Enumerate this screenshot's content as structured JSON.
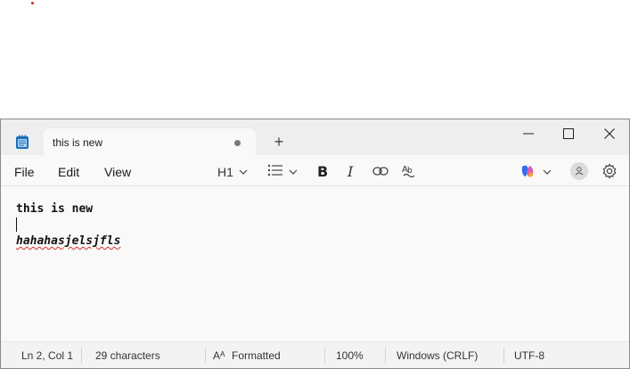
{
  "window": {
    "tab_title": "this is new",
    "new_tab_label": "+"
  },
  "menu": {
    "file": "File",
    "edit": "Edit",
    "view": "View"
  },
  "toolbar": {
    "heading_label": "H1",
    "bold_label": "B",
    "italic_label": "I",
    "icons": [
      "notepad-icon",
      "chevron-down-icon",
      "bulleted-list-icon",
      "link-icon",
      "spellcheck-icon",
      "copilot-icon",
      "account-icon",
      "gear-icon"
    ]
  },
  "editor": {
    "lines": [
      "this is new",
      "",
      "hahahasjelsjfls"
    ]
  },
  "status": {
    "position": "Ln 2, Col 1",
    "characters": "29 characters",
    "format_icon": "Aᴬ",
    "format": "Formatted",
    "zoom": "100%",
    "line_ending": "Windows (CRLF)",
    "encoding": "UTF-8"
  },
  "colors": {
    "spell_error_underline": "#d32f2f",
    "copilot_blue": "#2f6fed",
    "copilot_pink": "#e05ab8",
    "copilot_orange": "#f5a623"
  }
}
